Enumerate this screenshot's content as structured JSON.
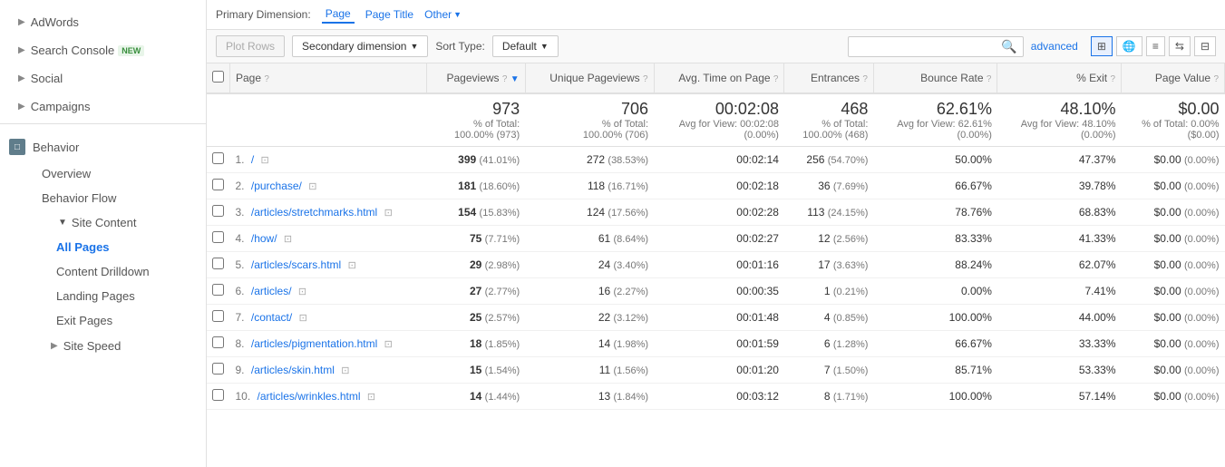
{
  "sidebar": {
    "adwords_label": "AdWords",
    "search_console_label": "Search Console",
    "new_badge": "NEW",
    "social_label": "Social",
    "campaigns_label": "Campaigns",
    "behavior_label": "Behavior",
    "overview_label": "Overview",
    "behavior_flow_label": "Behavior Flow",
    "site_content_label": "Site Content",
    "all_pages_label": "All Pages",
    "content_drilldown_label": "Content Drilldown",
    "landing_pages_label": "Landing Pages",
    "exit_pages_label": "Exit Pages",
    "site_speed_label": "Site Speed"
  },
  "topbar": {
    "primary_dimension_label": "Primary Dimension:",
    "page_tab": "Page",
    "page_title_tab": "Page Title",
    "other_label": "Other"
  },
  "toolbar": {
    "plot_rows_label": "Plot Rows",
    "secondary_dimension_label": "Secondary dimension",
    "sort_type_label": "Sort Type:",
    "default_label": "Default",
    "advanced_label": "advanced",
    "search_placeholder": ""
  },
  "table": {
    "headers": {
      "page": "Page",
      "pageviews": "Pageviews",
      "unique_pageviews": "Unique Pageviews",
      "avg_time": "Avg. Time on Page",
      "entrances": "Entrances",
      "bounce_rate": "Bounce Rate",
      "pct_exit": "% Exit",
      "page_value": "Page Value"
    },
    "summary": {
      "pageviews_value": "973",
      "pageviews_sub": "% of Total:\n100.00% (973)",
      "unique_pageviews_value": "706",
      "unique_pageviews_sub": "% of Total:\n100.00% (706)",
      "avg_time_value": "00:02:08",
      "avg_time_sub": "Avg for View: 00:02:08\n(0.00%)",
      "entrances_value": "468",
      "entrances_sub": "% of Total:\n100.00% (468)",
      "bounce_rate_value": "62.61%",
      "bounce_rate_sub": "Avg for View: 62.61%\n(0.00%)",
      "pct_exit_value": "48.10%",
      "pct_exit_sub": "Avg for View: 48.10%\n(0.00%)",
      "page_value_value": "$0.00",
      "page_value_sub": "% of Total: 0.00%\n($0.00)"
    },
    "rows": [
      {
        "num": "1.",
        "page": "/",
        "pageviews": "399",
        "pageviews_pct": "(41.01%)",
        "unique_pageviews": "272",
        "unique_pageviews_pct": "(38.53%)",
        "avg_time": "00:02:14",
        "entrances": "256",
        "entrances_pct": "(54.70%)",
        "bounce_rate": "50.00%",
        "pct_exit": "47.37%",
        "page_value": "$0.00",
        "page_value_pct": "(0.00%)"
      },
      {
        "num": "2.",
        "page": "/purchase/",
        "pageviews": "181",
        "pageviews_pct": "(18.60%)",
        "unique_pageviews": "118",
        "unique_pageviews_pct": "(16.71%)",
        "avg_time": "00:02:18",
        "entrances": "36",
        "entrances_pct": "(7.69%)",
        "bounce_rate": "66.67%",
        "pct_exit": "39.78%",
        "page_value": "$0.00",
        "page_value_pct": "(0.00%)"
      },
      {
        "num": "3.",
        "page": "/articles/stretchmarks.html",
        "pageviews": "154",
        "pageviews_pct": "(15.83%)",
        "unique_pageviews": "124",
        "unique_pageviews_pct": "(17.56%)",
        "avg_time": "00:02:28",
        "entrances": "113",
        "entrances_pct": "(24.15%)",
        "bounce_rate": "78.76%",
        "pct_exit": "68.83%",
        "page_value": "$0.00",
        "page_value_pct": "(0.00%)"
      },
      {
        "num": "4.",
        "page": "/how/",
        "pageviews": "75",
        "pageviews_pct": "(7.71%)",
        "unique_pageviews": "61",
        "unique_pageviews_pct": "(8.64%)",
        "avg_time": "00:02:27",
        "entrances": "12",
        "entrances_pct": "(2.56%)",
        "bounce_rate": "83.33%",
        "pct_exit": "41.33%",
        "page_value": "$0.00",
        "page_value_pct": "(0.00%)"
      },
      {
        "num": "5.",
        "page": "/articles/scars.html",
        "pageviews": "29",
        "pageviews_pct": "(2.98%)",
        "unique_pageviews": "24",
        "unique_pageviews_pct": "(3.40%)",
        "avg_time": "00:01:16",
        "entrances": "17",
        "entrances_pct": "(3.63%)",
        "bounce_rate": "88.24%",
        "pct_exit": "62.07%",
        "page_value": "$0.00",
        "page_value_pct": "(0.00%)"
      },
      {
        "num": "6.",
        "page": "/articles/",
        "pageviews": "27",
        "pageviews_pct": "(2.77%)",
        "unique_pageviews": "16",
        "unique_pageviews_pct": "(2.27%)",
        "avg_time": "00:00:35",
        "entrances": "1",
        "entrances_pct": "(0.21%)",
        "bounce_rate": "0.00%",
        "pct_exit": "7.41%",
        "page_value": "$0.00",
        "page_value_pct": "(0.00%)"
      },
      {
        "num": "7.",
        "page": "/contact/",
        "pageviews": "25",
        "pageviews_pct": "(2.57%)",
        "unique_pageviews": "22",
        "unique_pageviews_pct": "(3.12%)",
        "avg_time": "00:01:48",
        "entrances": "4",
        "entrances_pct": "(0.85%)",
        "bounce_rate": "100.00%",
        "pct_exit": "44.00%",
        "page_value": "$0.00",
        "page_value_pct": "(0.00%)"
      },
      {
        "num": "8.",
        "page": "/articles/pigmentation.html",
        "pageviews": "18",
        "pageviews_pct": "(1.85%)",
        "unique_pageviews": "14",
        "unique_pageviews_pct": "(1.98%)",
        "avg_time": "00:01:59",
        "entrances": "6",
        "entrances_pct": "(1.28%)",
        "bounce_rate": "66.67%",
        "pct_exit": "33.33%",
        "page_value": "$0.00",
        "page_value_pct": "(0.00%)"
      },
      {
        "num": "9.",
        "page": "/articles/skin.html",
        "pageviews": "15",
        "pageviews_pct": "(1.54%)",
        "unique_pageviews": "11",
        "unique_pageviews_pct": "(1.56%)",
        "avg_time": "00:01:20",
        "entrances": "7",
        "entrances_pct": "(1.50%)",
        "bounce_rate": "85.71%",
        "pct_exit": "53.33%",
        "page_value": "$0.00",
        "page_value_pct": "(0.00%)"
      },
      {
        "num": "10.",
        "page": "/articles/wrinkles.html",
        "pageviews": "14",
        "pageviews_pct": "(1.44%)",
        "unique_pageviews": "13",
        "unique_pageviews_pct": "(1.84%)",
        "avg_time": "00:03:12",
        "entrances": "8",
        "entrances_pct": "(1.71%)",
        "bounce_rate": "100.00%",
        "pct_exit": "57.14%",
        "page_value": "$0.00",
        "page_value_pct": "(0.00%)"
      }
    ]
  }
}
